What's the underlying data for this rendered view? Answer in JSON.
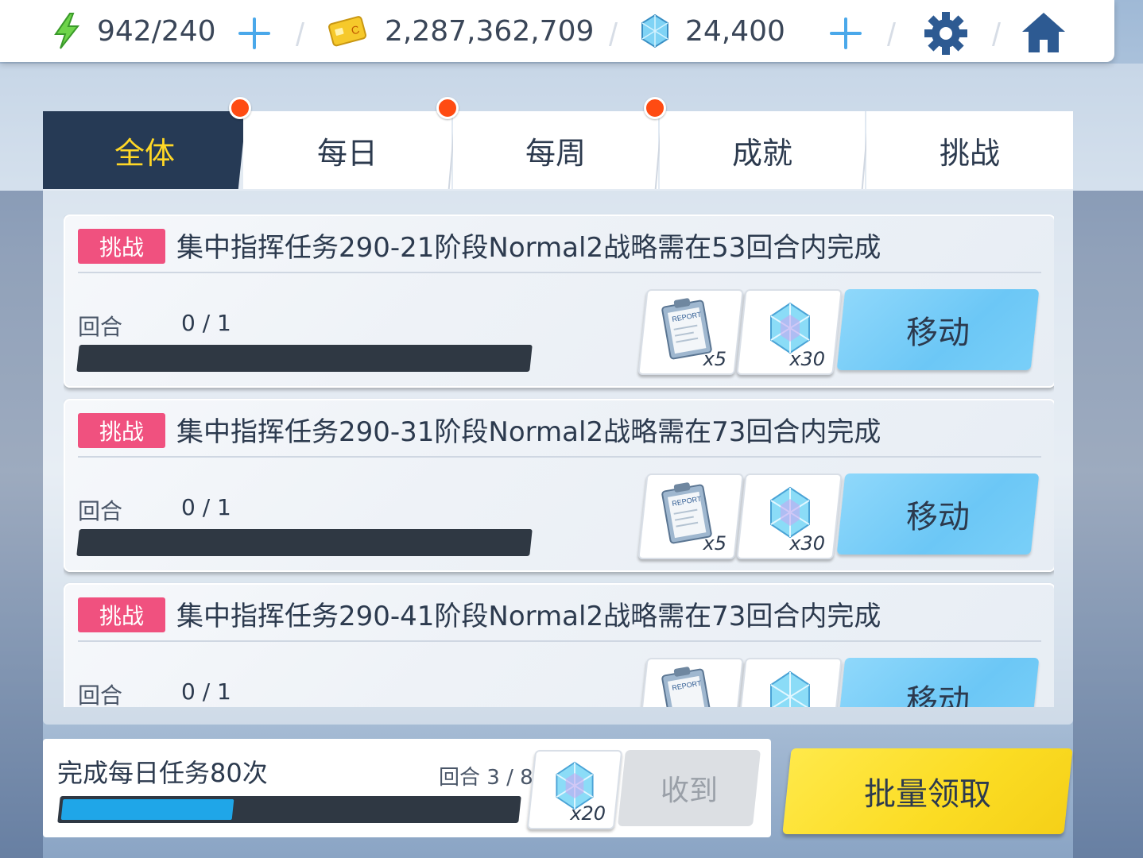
{
  "topbar": {
    "stamina": "942/240",
    "credits": "2,287,362,709",
    "gems": "24,400",
    "icons": [
      "lightning-icon",
      "credit-card-icon",
      "gem-icon",
      "plus-icon",
      "gear-icon",
      "home-icon"
    ]
  },
  "tabs": [
    {
      "label": "全体",
      "active": true,
      "dot": true
    },
    {
      "label": "每日",
      "active": false,
      "dot": true
    },
    {
      "label": "每周",
      "active": false,
      "dot": true
    },
    {
      "label": "成就",
      "active": false,
      "dot": false
    },
    {
      "label": "挑战",
      "active": false,
      "dot": false
    }
  ],
  "missions": [
    {
      "tag": "挑战",
      "title": "集中指挥任务290-21阶段Normal2战略需在53回合内完成",
      "progress_label": "回合",
      "progress": "0 / 1",
      "progress_value": 0,
      "rewards": [
        {
          "icon": "report-icon",
          "qty": "x5"
        },
        {
          "icon": "gem-icon",
          "qty": "x30"
        }
      ],
      "button": "移动"
    },
    {
      "tag": "挑战",
      "title": "集中指挥任务290-31阶段Normal2战略需在73回合内完成",
      "progress_label": "回合",
      "progress": "0 / 1",
      "progress_value": 0,
      "rewards": [
        {
          "icon": "report-icon",
          "qty": "x5"
        },
        {
          "icon": "gem-icon",
          "qty": "x30"
        }
      ],
      "button": "移动"
    },
    {
      "tag": "挑战",
      "title": "集中指挥任务290-41阶段Normal2战略需在73回合内完成",
      "progress_label": "回合",
      "progress": "0 / 1",
      "progress_value": 0,
      "rewards": [
        {
          "icon": "report-icon",
          "qty": ""
        },
        {
          "icon": "gem-icon",
          "qty": ""
        }
      ],
      "button": "移动"
    }
  ],
  "daily": {
    "title": "完成每日任务80次",
    "count": "回合 3 / 8",
    "progress_fraction": 0.375,
    "reward_qty": "x20",
    "claim_label": "收到"
  },
  "batch_label": "批量领取",
  "colors": {
    "tab_active_bg": "#263a55",
    "tab_active_text": "#ffd726",
    "tag_bg": "#f0517f",
    "move_btn": "#79cff8",
    "batch_btn": "#fbdc23",
    "progress_fill": "#1fa6e8",
    "notification_dot": "#ff4b12"
  }
}
